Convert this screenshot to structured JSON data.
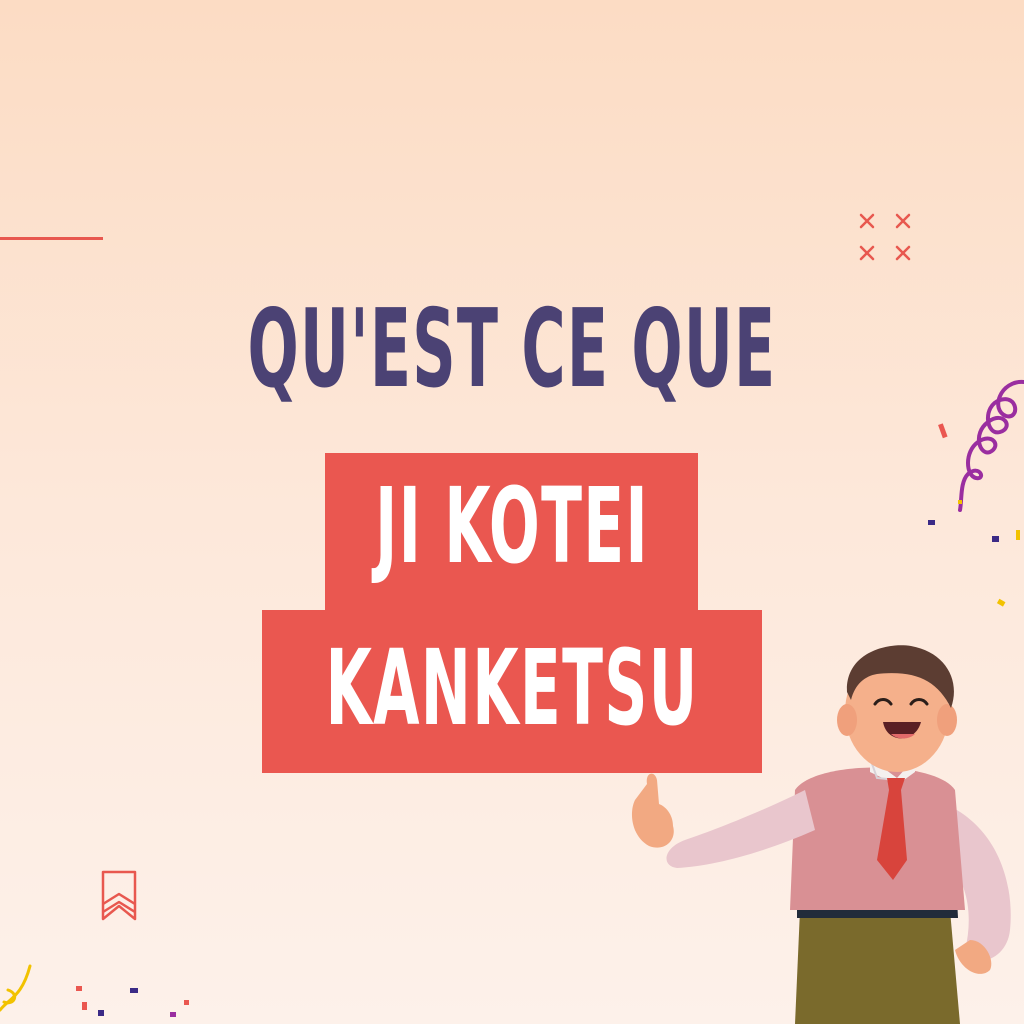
{
  "headline": {
    "line1": "QU'EST CE QUE",
    "line2": "JI KOTEI",
    "line3": "KANKETSU"
  },
  "colors": {
    "title": "#4b4274",
    "highlight": "#ea5750",
    "accent": "#e8584f",
    "background_top": "#fcdcc4",
    "background_bottom": "#fdf1ea"
  },
  "decorations": [
    "accent-line",
    "cross-icons",
    "bookmark-icon",
    "confetti-swirl",
    "character-thumbs-up"
  ]
}
